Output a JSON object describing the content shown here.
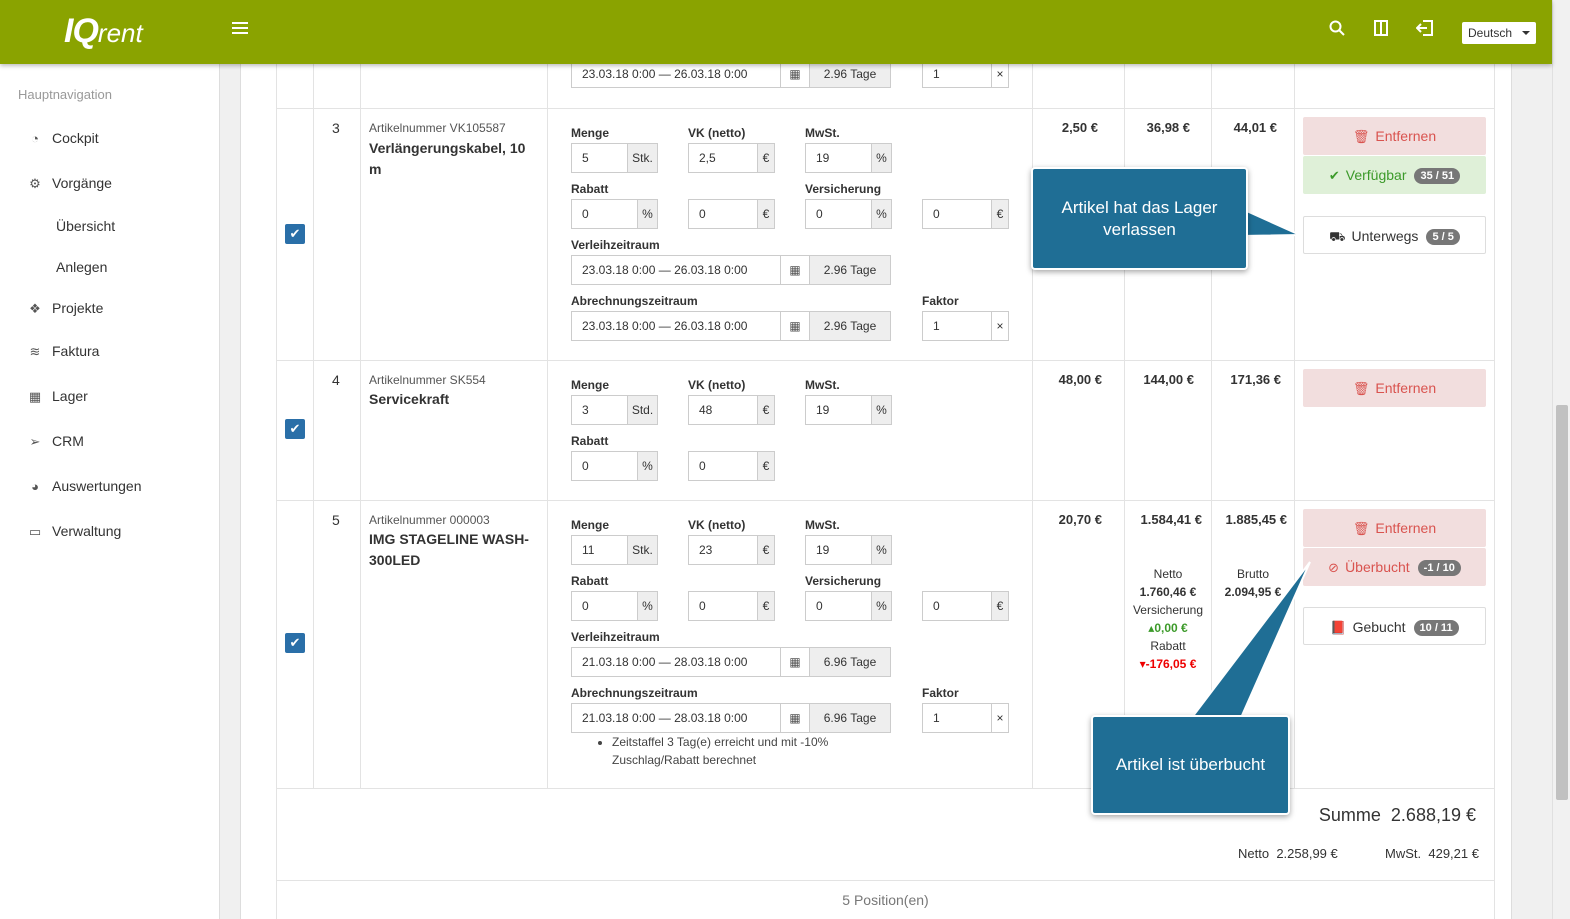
{
  "app": {
    "logo": "IQ",
    "logo_sub": "rent",
    "language": "Deutsch"
  },
  "nav": {
    "header": "Hauptnavigation",
    "items": [
      {
        "label": "Cockpit",
        "icon": "gauge-icon"
      },
      {
        "label": "Vorgänge",
        "icon": "gears-icon"
      },
      {
        "label": "Übersicht",
        "sub": true
      },
      {
        "label": "Anlegen",
        "sub": true
      },
      {
        "label": "Projekte",
        "icon": "tags-icon"
      },
      {
        "label": "Faktura",
        "icon": "layers-icon"
      },
      {
        "label": "Lager",
        "icon": "cubes-icon"
      },
      {
        "label": "CRM",
        "icon": "paper-plane-icon"
      },
      {
        "label": "Auswertungen",
        "icon": "pie-chart-icon"
      },
      {
        "label": "Verwaltung",
        "icon": "folder-icon"
      }
    ]
  },
  "labels": {
    "menge": "Menge",
    "vk": "VK (netto)",
    "mwst": "MwSt.",
    "rabatt": "Rabatt",
    "versicherung": "Versicherung",
    "verleih": "Verleihzeitraum",
    "abrechnung": "Abrechnungszeitraum",
    "faktor": "Faktor",
    "entfernen": "Entfernen",
    "verfuegbar": "Verfügbar",
    "unterwegs": "Unterwegs",
    "ueberbucht": "Überbucht",
    "gebucht": "Gebucht",
    "netto": "Netto",
    "brutto": "Brutto",
    "versicherung_s": "Versicherung",
    "rabatt_s": "Rabatt"
  },
  "units": {
    "pct": "%",
    "eur": "€",
    "stk": "Stk.",
    "std": "Std.",
    "x": "×"
  },
  "row_top": {
    "period": "23.03.18 0:00 — 26.03.18 0:00",
    "days": "2.96 Tage",
    "factor": "1"
  },
  "row3": {
    "pos": "3",
    "artnr": "Artikelnummer VK105587",
    "name": "Verlängerungskabel, 10 m",
    "menge": "5",
    "vk": "2,5",
    "mwst": "19",
    "rabatt": "0",
    "rabatt_eur": "0",
    "versicherung": "0",
    "versicherung_eur": "0",
    "verleih": "23.03.18 0:00 — 26.03.18 0:00",
    "verleih_days": "2.96 Tage",
    "abrechnung": "23.03.18 0:00 — 26.03.18 0:00",
    "abrechnung_days": "2.96 Tage",
    "faktor": "1",
    "price": "2,50 €",
    "netto": "36,98 €",
    "brutto": "44,01 €",
    "avail_badge": "35 / 51",
    "unterwegs_badge": "5 / 5"
  },
  "row4": {
    "pos": "4",
    "artnr": "Artikelnummer SK554",
    "name": "Servicekraft",
    "menge": "3",
    "vk": "48",
    "mwst": "19",
    "rabatt": "0",
    "rabatt_eur": "0",
    "price": "48,00 €",
    "netto": "144,00 €",
    "brutto": "171,36 €"
  },
  "row5": {
    "pos": "5",
    "artnr": "Artikelnummer 000003",
    "name": "IMG STAGELINE WASH-300LED",
    "menge": "11",
    "vk": "23",
    "mwst": "19",
    "rabatt": "0",
    "rabatt_eur": "0",
    "versicherung": "0",
    "versicherung_eur": "0",
    "verleih": "21.03.18 0:00 — 28.03.18 0:00",
    "verleih_days": "6.96 Tage",
    "abrechnung": "21.03.18 0:00 — 28.03.18 0:00",
    "abrechnung_days": "6.96 Tage",
    "faktor": "1",
    "note": "Zeitstaffel 3 Tag(e) erreicht und mit -10% Zuschlag/Rabatt berechnet",
    "price": "20,70 €",
    "netto": "1.584,41 €",
    "brutto": "1.885,45 €",
    "netto_detail": "1.760,46 €",
    "brutto_detail": "2.094,95 €",
    "vers_detail": "0,00 €",
    "rabatt_detail": "-176,05 €",
    "over_badge": "-1 / 10",
    "gebucht_badge": "10 / 11"
  },
  "callouts": {
    "left_store": "Artikel hat das Lager verlassen",
    "overbooked": "Artikel ist überbucht"
  },
  "summary": {
    "summe_label": "Summe",
    "summe": "2.688,19 €",
    "netto_label": "Netto",
    "netto": "2.258,99 €",
    "mwst_label": "MwSt.",
    "mwst": "429,21 €",
    "positions": "5 Position(en)"
  }
}
